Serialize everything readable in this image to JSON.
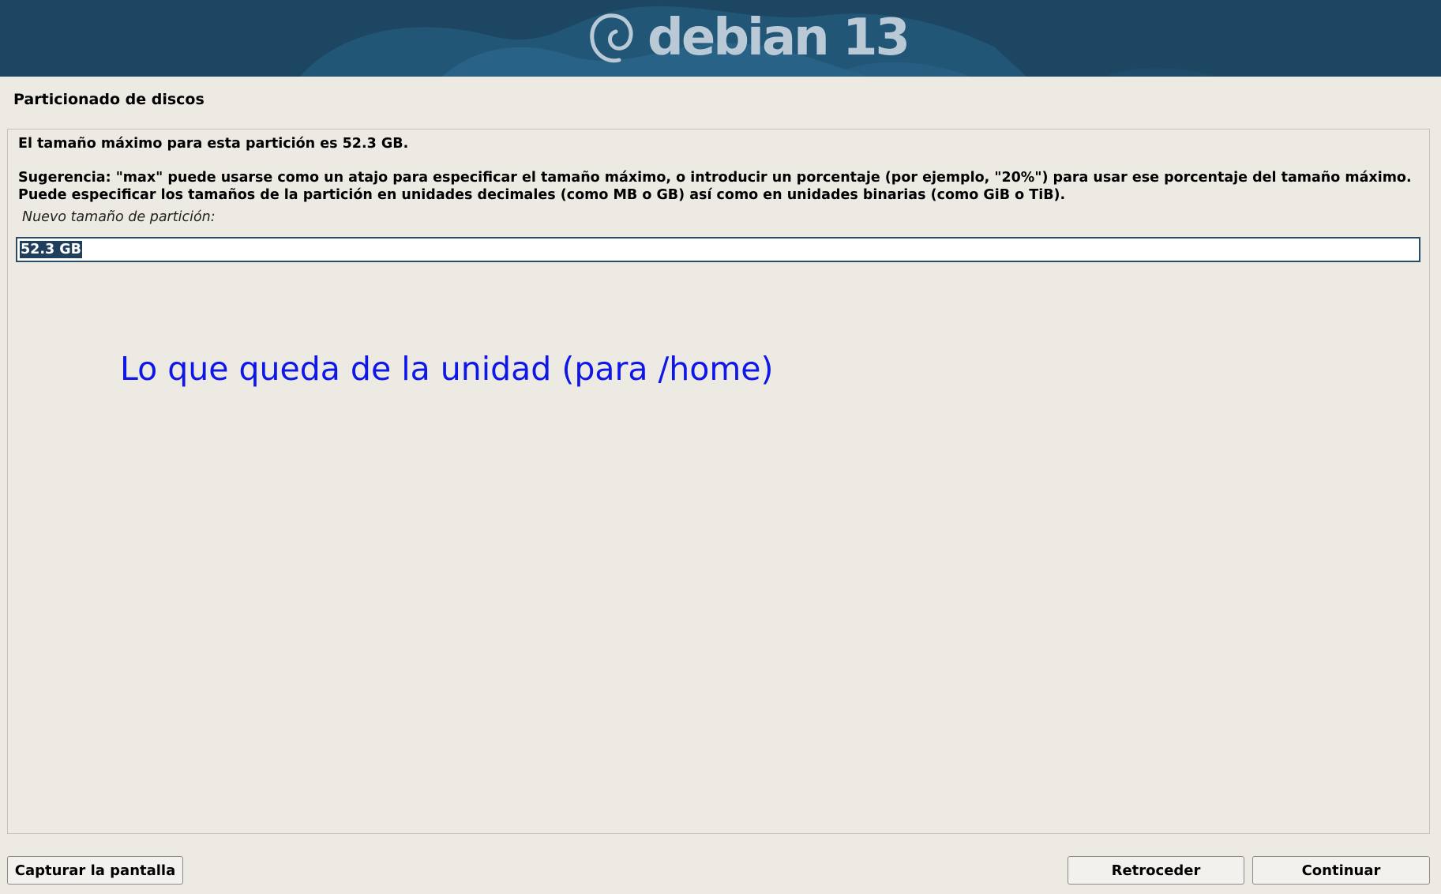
{
  "banner": {
    "logo_text": "debian 13",
    "background_color": "#1d4663",
    "logo_color": "#b9c9d6"
  },
  "step": {
    "title": "Particionado de discos"
  },
  "content": {
    "max_size_message": "El tamaño máximo para esta partición es 52.3 GB.",
    "hint_message": "Sugerencia: \"max\" puede usarse como un atajo para especificar el tamaño máximo, o introducir un porcentaje (por ejemplo, \"20%\") para usar ese porcentaje del tamaño máximo. Puede especificar los tamaños de la partición en unidades decimales (como MB o GB) así como en unidades binarias (como GiB o TiB).",
    "field_label": "Nuevo tamaño de partición:",
    "field_value": "52.3 GB",
    "annotation": "Lo que queda de la unidad (para /home)",
    "annotation_color": "#0d17e8"
  },
  "buttons": {
    "screenshot": "Capturar la pantalla",
    "back": "Retroceder",
    "continue": "Continuar"
  }
}
